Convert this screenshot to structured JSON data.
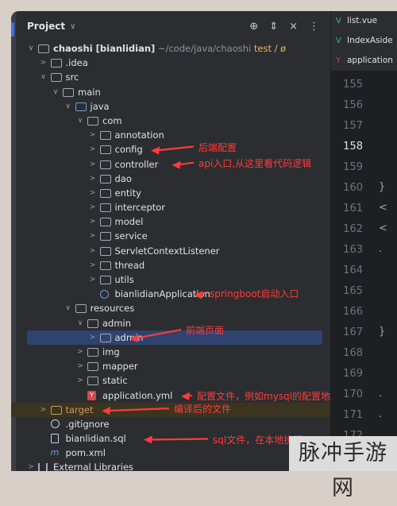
{
  "header": {
    "title": "Project",
    "chevron": "∨"
  },
  "header_icons": [
    "crosshair-icon",
    "expand-collapse-icon",
    "close-icon",
    "more-icon"
  ],
  "tree": [
    {
      "name": "chaoshi",
      "suffix": " [bianlidian]",
      "path": "  ~/code/java/chaoshi",
      "extra": " test / ø",
      "depth": 0,
      "arrow": "∨",
      "icon": "folder"
    },
    {
      "name": ".idea",
      "depth": 1,
      "arrow": ">",
      "icon": "folder"
    },
    {
      "name": "src",
      "depth": 1,
      "arrow": "∨",
      "icon": "folder"
    },
    {
      "name": "main",
      "depth": 2,
      "arrow": "∨",
      "icon": "folder"
    },
    {
      "name": "java",
      "depth": 3,
      "arrow": "∨",
      "icon": "folder-blue"
    },
    {
      "name": "com",
      "depth": 4,
      "arrow": "∨",
      "icon": "folder"
    },
    {
      "name": "annotation",
      "depth": 5,
      "arrow": ">",
      "icon": "folder"
    },
    {
      "name": "config",
      "depth": 5,
      "arrow": ">",
      "icon": "folder"
    },
    {
      "name": "controller",
      "depth": 5,
      "arrow": ">",
      "icon": "folder"
    },
    {
      "name": "dao",
      "depth": 5,
      "arrow": ">",
      "icon": "folder"
    },
    {
      "name": "entity",
      "depth": 5,
      "arrow": ">",
      "icon": "folder"
    },
    {
      "name": "interceptor",
      "depth": 5,
      "arrow": ">",
      "icon": "folder"
    },
    {
      "name": "model",
      "depth": 5,
      "arrow": ">",
      "icon": "folder"
    },
    {
      "name": "service",
      "depth": 5,
      "arrow": ">",
      "icon": "folder"
    },
    {
      "name": "ServletContextListener",
      "depth": 5,
      "arrow": ">",
      "icon": "folder"
    },
    {
      "name": "thread",
      "depth": 5,
      "arrow": ">",
      "icon": "folder"
    },
    {
      "name": "utils",
      "depth": 5,
      "arrow": ">",
      "icon": "folder"
    },
    {
      "name": "bianlidianApplication",
      "depth": 5,
      "arrow": "",
      "icon": "class"
    },
    {
      "name": "resources",
      "depth": 3,
      "arrow": "∨",
      "icon": "folder-res"
    },
    {
      "name": "admin",
      "depth": 4,
      "arrow": "∨",
      "icon": "folder"
    },
    {
      "name": "admin",
      "depth": 5,
      "arrow": ">",
      "icon": "folder",
      "selected": true
    },
    {
      "name": "img",
      "depth": 4,
      "arrow": ">",
      "icon": "folder"
    },
    {
      "name": "mapper",
      "depth": 4,
      "arrow": ">",
      "icon": "folder"
    },
    {
      "name": "static",
      "depth": 4,
      "arrow": ">",
      "icon": "folder"
    },
    {
      "name": "application.yml",
      "depth": 4,
      "arrow": "",
      "icon": "yml"
    },
    {
      "name": "target",
      "depth": 1,
      "arrow": ">",
      "icon": "folder-orange",
      "target": true
    },
    {
      "name": ".gitignore",
      "depth": 1,
      "arrow": "",
      "icon": "git"
    },
    {
      "name": "bianlidian.sql",
      "depth": 1,
      "arrow": "",
      "icon": "file"
    },
    {
      "name": "pom.xml",
      "depth": 1,
      "arrow": "",
      "icon": "maven"
    },
    {
      "name": "External Libraries",
      "depth": 0,
      "arrow": ">",
      "icon": "lib"
    }
  ],
  "annotations": [
    {
      "text": "后端配置",
      "row": 7
    },
    {
      "text": "api入口,从这里看代码逻辑",
      "row": 8
    },
    {
      "text": "springboot启动入口",
      "row": 17
    },
    {
      "text": "前端页面",
      "row": 20
    },
    {
      "text": "配置文件，例如mysql的配置地址",
      "row": 24
    },
    {
      "text": "编译后的文件",
      "row": 25
    },
    {
      "text": "sql文件，在本地执行",
      "row": 27
    }
  ],
  "editor": {
    "tabs": [
      {
        "label": "list.vue",
        "icon": "V",
        "color": "green"
      },
      {
        "label": "IndexAside",
        "icon": "V",
        "color": "green"
      },
      {
        "label": "application",
        "icon": "Y",
        "color": "red"
      }
    ],
    "line_numbers": [
      "155",
      "156",
      "157",
      "158",
      "159",
      "160",
      "161",
      "162",
      "163",
      "164",
      "165",
      "166",
      "167",
      "168",
      "169",
      "170",
      "171",
      "172"
    ],
    "active_line": "158",
    "code_marks": [
      {
        "line": "160",
        "text": "}"
      },
      {
        "line": "161",
        "text": "<"
      },
      {
        "line": "162",
        "text": "<"
      },
      {
        "line": "163",
        "text": "."
      },
      {
        "line": "167",
        "text": "}"
      },
      {
        "line": "170",
        "text": "."
      },
      {
        "line": "171",
        "text": "."
      }
    ]
  },
  "watermark": "脉冲手游网",
  "colors": {
    "annotation": "#ff3b3b",
    "selection": "#2e436e",
    "panel": "#2b2d30"
  }
}
